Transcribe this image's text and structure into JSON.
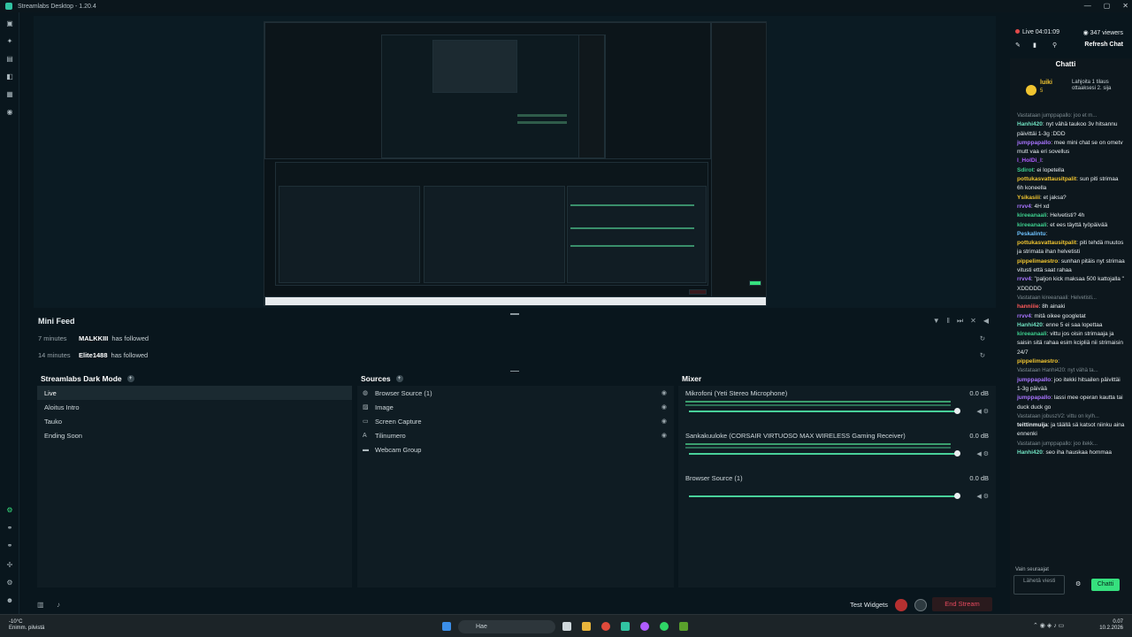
{
  "window": {
    "title": "Streamlabs Desktop - 1.20.4",
    "controls": [
      "—",
      "▢",
      "✕"
    ]
  },
  "sidenav": {
    "icons": [
      "editor-icon",
      "themes-icon",
      "store-icon",
      "alerts-icon",
      "dashboard-icon",
      "settings-circle-icon",
      "plugin-icon",
      "studio-mode-icon",
      "highlighter-icon",
      "apps-icon",
      "gear-icon",
      "profile-icon"
    ]
  },
  "minifeed": {
    "title": "Mini Feed",
    "rows": [
      {
        "ago": "7 minutes",
        "name": "MALKKIII",
        "action": "has followed"
      },
      {
        "ago": "14 minutes",
        "name": "Elite1488",
        "action": "has followed"
      }
    ]
  },
  "scenes": {
    "title": "Streamlabs Dark Mode",
    "items": [
      "Live",
      "Aloitus Intro",
      "Tauko",
      "Ending Soon"
    ]
  },
  "sources": {
    "title": "Sources",
    "items": [
      {
        "icon": "globe",
        "name": "Browser Source (1)"
      },
      {
        "icon": "image",
        "name": "Image"
      },
      {
        "icon": "monitor",
        "name": "Screen Capture"
      },
      {
        "icon": "text",
        "name": "Tilinumero"
      },
      {
        "icon": "folder",
        "name": "Webcam Group"
      }
    ]
  },
  "mixer": {
    "title": "Mixer",
    "items": [
      {
        "name": "Mikrofoni (Yeti Stereo Microphone)",
        "db": "0.0 dB"
      },
      {
        "name": "Sankakuuloke (CORSAIR VIRTUOSO MAX WIRELESS Gaming Receiver)",
        "db": "0.0 dB"
      },
      {
        "name": "Browser Source (1)",
        "db": "0.0 dB"
      }
    ]
  },
  "footer": {
    "test_widgets": "Test Widgets",
    "end_stream": "End Stream"
  },
  "chat": {
    "live": "Live 04:01:09",
    "viewers": "347 viewers",
    "refresh": "Refresh Chat",
    "title": "Chatti",
    "hype": {
      "user": "luiki",
      "count": "5",
      "text": "Lahjoita 1 tilaus ottaaksesi 2. sija"
    },
    "messages": [
      {
        "reply": "Vastataan jumppapallo: joo et m..."
      },
      {
        "user": "Hanhi420",
        "color": "#6fe0c0",
        "text": "nyt vähä taukoo 3v hitsannu päivittäi 1-3g :DDD"
      },
      {
        "user": "jumppapallo",
        "color": "#a974ff",
        "text": "mee mini chat se on ometv mutt vaa eri sovellus"
      },
      {
        "user": "l_HolDi_l",
        "color": "#b05cff",
        "text": ""
      },
      {
        "user": "Sdirot",
        "color": "#3ecf8e",
        "text": "ei lopetella"
      },
      {
        "user": "pottukasvattausitpalit",
        "color": "#f0c430",
        "text": "sun piti strimaa 6h koneella"
      },
      {
        "user": "Ysikasiii",
        "color": "#f0c430",
        "text": "et jaksa?"
      },
      {
        "user": "rrvv4",
        "color": "#a974ff",
        "text": "4H xd"
      },
      {
        "user": "kireeanaali",
        "color": "#3ecf8e",
        "text": "Helvetisti? 4h"
      },
      {
        "user": "kireeanaali",
        "color": "#3ecf8e",
        "text": "et ees täyttä työpäivää"
      },
      {
        "user": "Peskalintu",
        "color": "#6fc3ff",
        "text": ""
      },
      {
        "user": "pottukasvattausitpalit",
        "color": "#f0c430",
        "text": "piti tehdä muutos ja strimata ihan helvetisti"
      },
      {
        "user": "pippelimaestro",
        "color": "#f0c430",
        "text": "sunhan pitäis nyt strimaa vitusti että saat rahaa"
      },
      {
        "user": "rrvv4",
        "color": "#a974ff",
        "text": "\"paljon kick maksaa 500 kattojalla \" XDDDDD"
      },
      {
        "reply": "Vastataan kireeanaali: Helvetisti..."
      },
      {
        "user": "hanniiie",
        "color": "#ff5a5a",
        "text": "8h ainaki"
      },
      {
        "user": "rrvv4",
        "color": "#a974ff",
        "text": "mitä oikee googletat"
      },
      {
        "user": "Hanhi420",
        "color": "#6fe0c0",
        "text": "enne 5 ei saa lopettaa"
      },
      {
        "user": "kireeanaali",
        "color": "#3ecf8e",
        "text": "vittu jos oisin strimaaja ja saisin sitä rahaa esim kcipliä nii strimaisin 24/7"
      },
      {
        "user": "pippelimaestro",
        "color": "#f0c430",
        "text": ""
      },
      {
        "reply": "Vastataan Hanhi420: nyt vähä ta..."
      },
      {
        "user": "jumppapallo",
        "color": "#a974ff",
        "text": "joo itekki hitsailen päivittäi 1-3g päivää"
      },
      {
        "user": "jumppapallo",
        "color": "#a974ff",
        "text": "lassi mee operan kautta tai duck duck go"
      },
      {
        "reply": "Vastataan jobuszV2: vittu on kylh..."
      },
      {
        "user": "teittinmuija",
        "color": "#e7edf0",
        "text": "ja täällä sä katsot niinku aina ennenki"
      },
      {
        "reply": "Vastataan jumppapallo: joo itekk..."
      },
      {
        "user": "Hanhi420",
        "color": "#6fe0c0",
        "text": "seo iha hauskaa hommaa"
      }
    ],
    "followers_only": "Vain seuraajat",
    "send_placeholder": "Lähetä viesti",
    "send_button": "Chatti"
  },
  "taskbar": {
    "weather_temp": "-10°C",
    "weather_desc": "Enimm. pilvistä",
    "search": "Hae",
    "time": "0.07",
    "date": "10.2.2026"
  }
}
